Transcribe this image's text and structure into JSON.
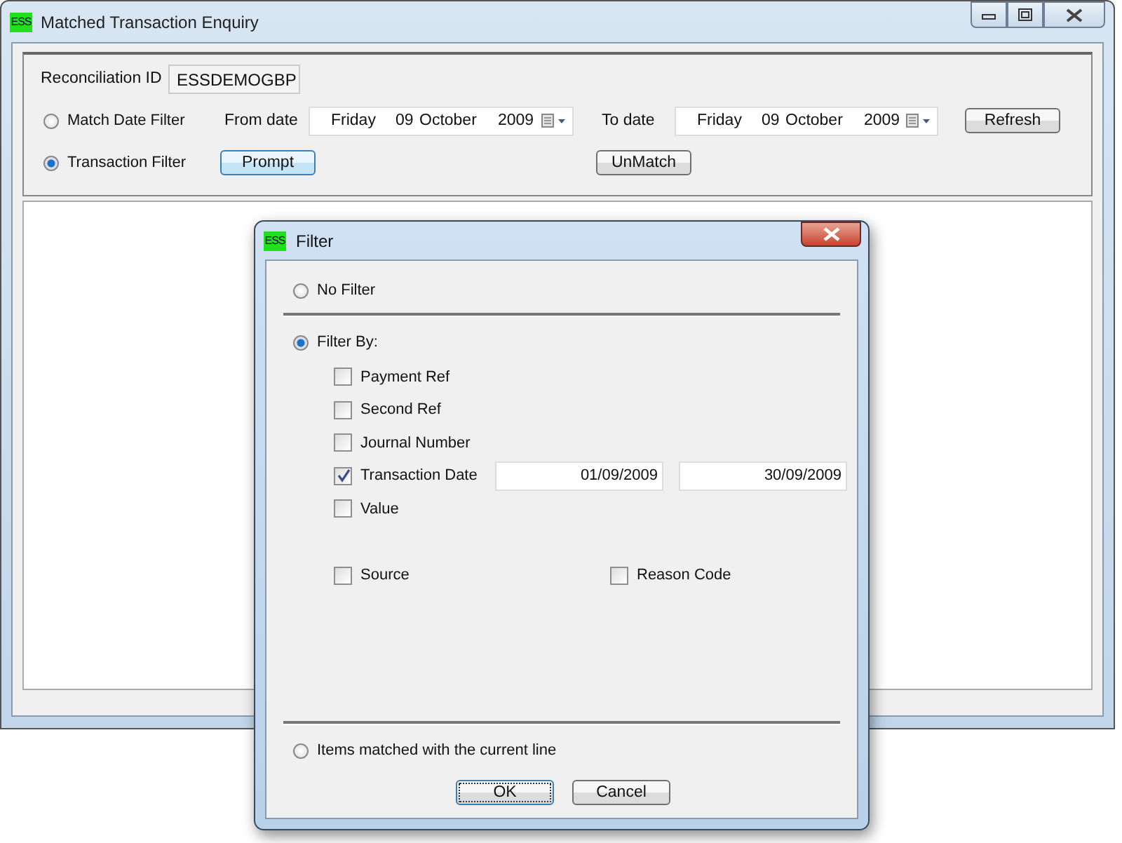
{
  "window": {
    "title": "Matched Transaction Enquiry",
    "icon_label": "ESS"
  },
  "reconciliation": {
    "label": "Reconciliation ID",
    "value": "ESSDEMOGBP"
  },
  "filter_modes": [
    {
      "label": "Match Date Filter",
      "selected": false
    },
    {
      "label": "Transaction Filter",
      "selected": true
    }
  ],
  "from_date": {
    "label": "From date",
    "weekday": "Friday",
    "day": "09",
    "month": "October",
    "year": "2009"
  },
  "to_date": {
    "label": "To date",
    "weekday": "Friday",
    "day": "09",
    "month": "October",
    "year": "2009"
  },
  "buttons": {
    "refresh": "Refresh",
    "prompt": "Prompt",
    "unmatch": "UnMatch"
  },
  "dialog": {
    "title": "Filter",
    "icon_label": "ESS",
    "no_filter": {
      "label": "No Filter",
      "selected": false
    },
    "filter_by": {
      "label": "Filter By:",
      "selected": true
    },
    "criteria": [
      {
        "label": "Payment Ref",
        "checked": false
      },
      {
        "label": "Second Ref",
        "checked": false
      },
      {
        "label": "Journal Number",
        "checked": false
      },
      {
        "label": "Transaction Date",
        "checked": true,
        "from": "01/09/2009",
        "to": "30/09/2009"
      },
      {
        "label": "Value",
        "checked": false
      }
    ],
    "extra_criteria": [
      {
        "label": "Source",
        "checked": false
      },
      {
        "label": "Reason Code",
        "checked": false
      }
    ],
    "matched_line": {
      "label": "Items matched with the current line",
      "selected": false
    },
    "ok": "OK",
    "cancel": "Cancel"
  }
}
